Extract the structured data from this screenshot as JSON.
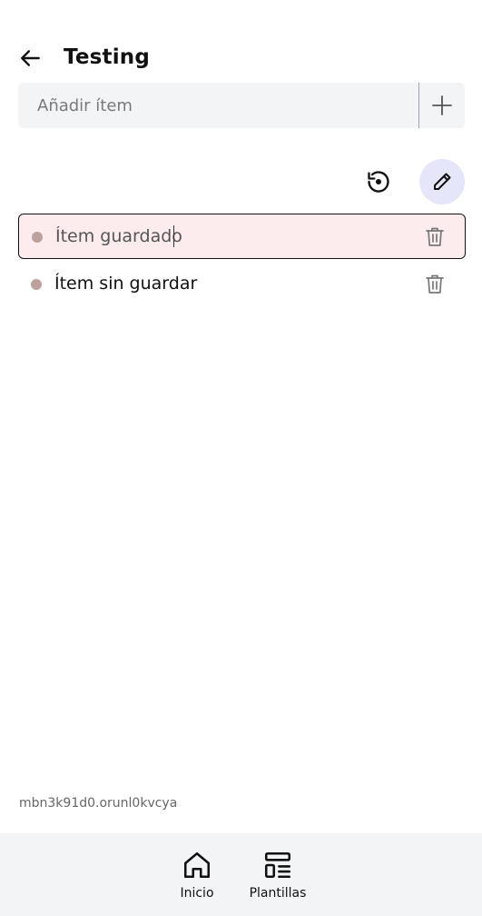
{
  "header": {
    "back_icon": "arrow-left-icon",
    "title": "Testing"
  },
  "add_item": {
    "placeholder": "Añadir ítem",
    "value": "",
    "add_icon": "plus-icon"
  },
  "toolbar": {
    "restore_icon": "history-icon",
    "edit_icon": "pencil-icon"
  },
  "items": [
    {
      "label": "Ítem guardado",
      "state": "editing",
      "delete_icon": "trash-icon"
    },
    {
      "label": "Ítem sin guardar",
      "state": "normal",
      "delete_icon": "trash-icon"
    }
  ],
  "footer": {
    "id_text": "mbn3k91d0.orunl0kvcya"
  },
  "bottom_nav": {
    "items": [
      {
        "label": "Inicio",
        "icon": "home-icon"
      },
      {
        "label": "Plantillas",
        "icon": "templates-icon"
      }
    ]
  },
  "colors": {
    "editing_background": "#fdeced",
    "edit_button_background": "#e6e6fb",
    "bullet": "#bca19c",
    "surface": "#f3f4f6"
  }
}
